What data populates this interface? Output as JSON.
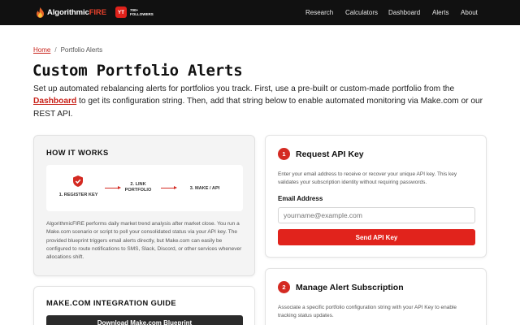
{
  "nav": {
    "brand_main": "Algorithmic",
    "brand_accent": "FIRE",
    "yt_badge": "YT",
    "yt_count": "700+",
    "yt_label": "FOLLOWERS",
    "links": [
      "Research",
      "Calculators",
      "Dashboard",
      "Alerts",
      "About"
    ]
  },
  "breadcrumb": {
    "home": "Home",
    "separator": "/",
    "current": "Portfolio Alerts"
  },
  "page": {
    "title": "Custom Portfolio Alerts",
    "intro_before": "Set up automated rebalancing alerts for portfolios you track. First, use a pre-built or custom-made portfolio from the ",
    "intro_link": "Dashboard",
    "intro_after": " to get its configuration string. Then, add that string below to enable automated monitoring via Make.com or our REST API."
  },
  "how_it_works": {
    "title": "HOW IT WORKS",
    "step1": "1. REGISTER KEY",
    "step2_line1": "2. LINK",
    "step2_line2": "PORTFOLIO",
    "step3": "3. MAKE / API",
    "description": "AlgorithmicFIRE performs daily market trend analysis after market close. You run a Make.com scenario or script to poll your consolidated status via your API key. The provided blueprint triggers email alerts directly, but Make.com can easily be configured to route notifications to SMS, Slack, Discord, or other services whenever allocations shift."
  },
  "integration": {
    "title": "MAKE.COM INTEGRATION GUIDE",
    "download_label": "Download Make.com Blueprint"
  },
  "request_key": {
    "number": "1",
    "title": "Request API Key",
    "description": "Enter your email address to receive or recover your unique API key. This key validates your subscription identity without requiring passwords.",
    "email_label": "Email Address",
    "email_placeholder": "yourname@example.com",
    "email_value": "",
    "button_label": "Send API Key"
  },
  "manage": {
    "number": "2",
    "title": "Manage Alert Subscription",
    "description": "Associate a specific portfolio configuration string with your API Key to enable tracking status updates."
  },
  "colors": {
    "accent": "#e1231c",
    "nav_bg": "#111111",
    "link": "#c8221a"
  }
}
